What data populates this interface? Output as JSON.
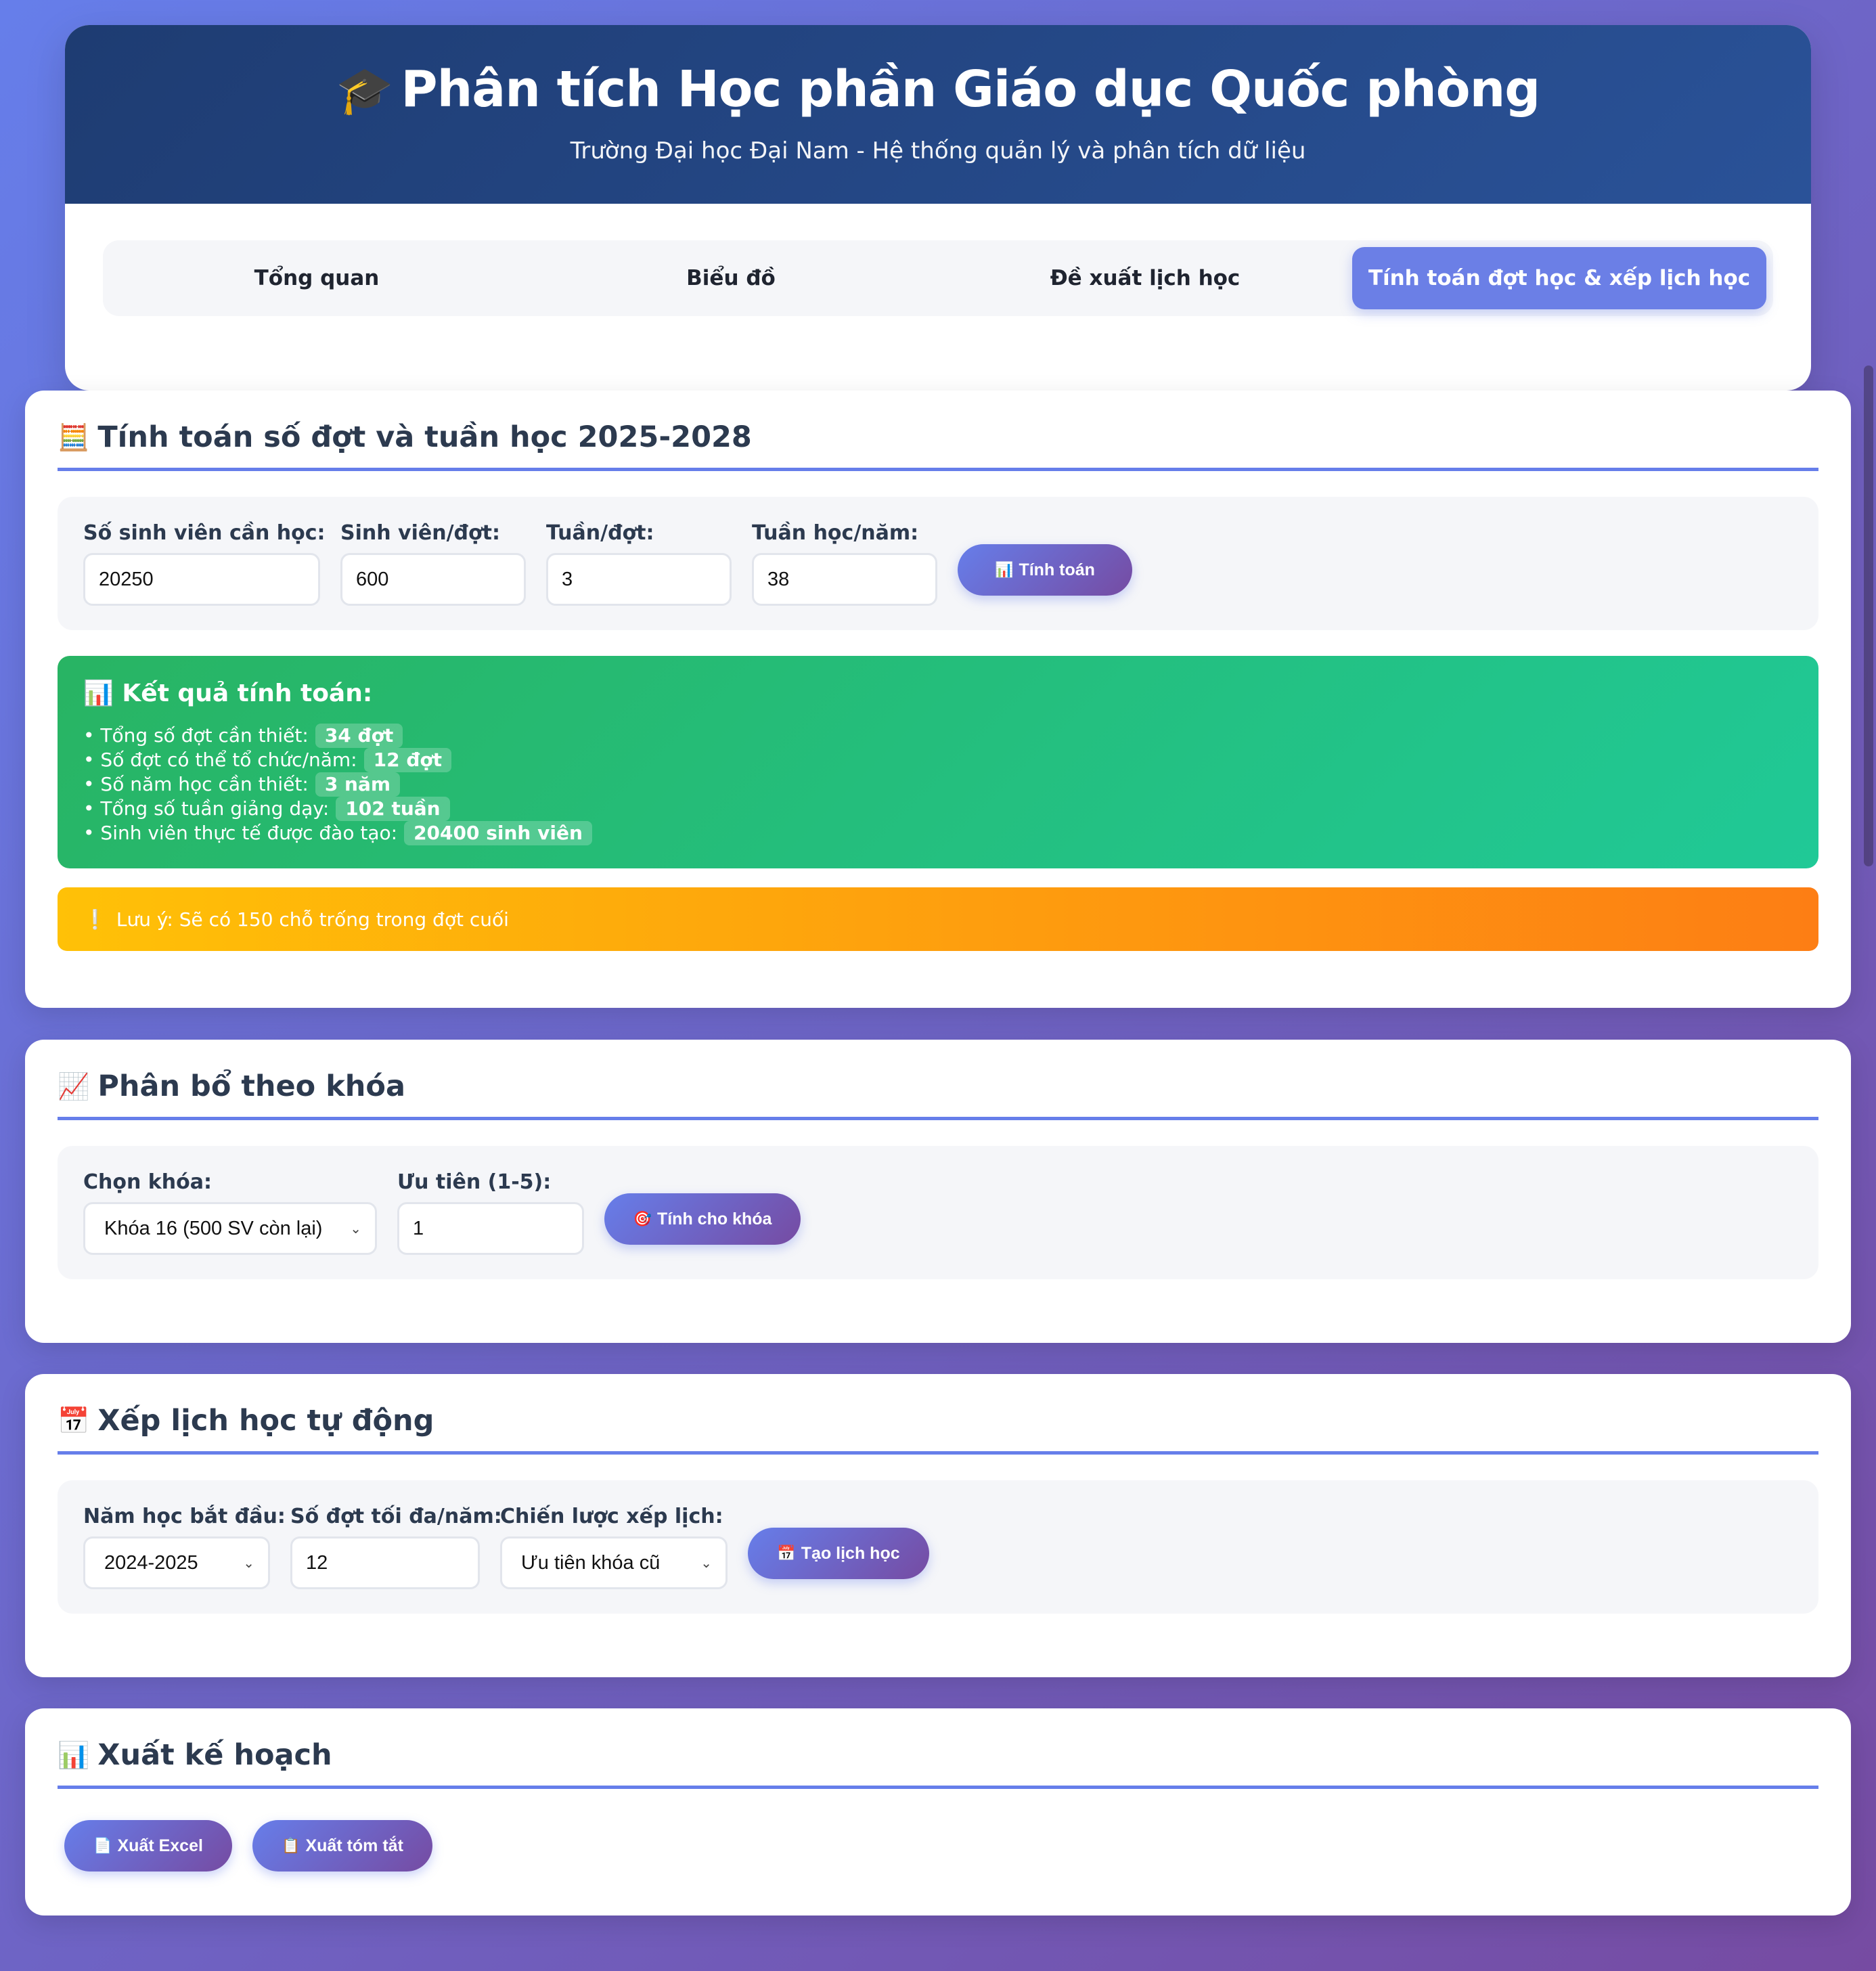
{
  "header": {
    "icon": "graduation-cap-icon",
    "emoji": "🎓",
    "title": "Phân tích Học phần Giáo dục Quốc phòng",
    "subtitle": "Trường Đại học Đại Nam - Hệ thống quản lý và phân tích dữ liệu"
  },
  "tabs": [
    {
      "label": "Tổng quan",
      "active": false
    },
    {
      "label": "Biểu đồ",
      "active": false
    },
    {
      "label": "Đề xuất lịch học",
      "active": false
    },
    {
      "label": "Tính toán đợt học & xếp lịch học",
      "active": true
    }
  ],
  "calc": {
    "emoji": "🧮",
    "title": "Tính toán số đợt và tuần học 2025-2028",
    "fields": [
      {
        "label": "Số sinh viên cần học:",
        "value": "20250"
      },
      {
        "label": "Sinh viên/đợt:",
        "value": "600"
      },
      {
        "label": "Tuần/đợt:",
        "value": "3"
      },
      {
        "label": "Tuần học/năm:",
        "value": "38"
      }
    ],
    "button": {
      "emoji": "📊",
      "label": "Tính toán"
    },
    "result": {
      "emoji": "📊",
      "title": "Kết quả tính toán:",
      "rows": [
        {
          "label": "• Tổng số đợt cần thiết:",
          "value": "34 đợt"
        },
        {
          "label": "• Số đợt có thể tổ chức/năm:",
          "value": "12 đợt"
        },
        {
          "label": "• Số năm học cần thiết:",
          "value": "3 năm"
        },
        {
          "label": "• Tổng số tuần giảng dạy:",
          "value": "102 tuần"
        },
        {
          "label": "• Sinh viên thực tế được đào tạo:",
          "value": "20400 sinh viên"
        }
      ]
    },
    "warning": {
      "emoji": "❕",
      "text": "Lưu ý: Sẽ có 150 chỗ trống trong đợt cuối"
    }
  },
  "allocation": {
    "emoji": "📈",
    "title": "Phân bổ theo khóa",
    "course_label": "Chọn khóa:",
    "course_value": "Khóa 16 (500 SV còn lại)",
    "priority_label": "Ưu tiên (1-5):",
    "priority_value": "1",
    "button": {
      "emoji": "🎯",
      "label": "Tính cho khóa"
    }
  },
  "schedule": {
    "emoji": "📅",
    "title": "Xếp lịch học tự động",
    "year_label": "Năm học bắt đầu:",
    "year_value": "2024-2025",
    "max_label": "Số đợt tối đa/năm:",
    "max_value": "12",
    "strategy_label": "Chiến lược xếp lịch:",
    "strategy_value": "Ưu tiên khóa cũ",
    "button": {
      "emoji": "📅",
      "label": "Tạo lịch học"
    }
  },
  "export": {
    "emoji": "📊",
    "title": "Xuất kế hoạch",
    "excel": {
      "emoji": "📄",
      "label": "Xuất Excel"
    },
    "summary": {
      "emoji": "📋",
      "label": "Xuất tóm tắt"
    }
  },
  "colors": {
    "bg_start": "#667eea",
    "bg_end": "#764ba2",
    "header_start": "#1e3c72",
    "header_end": "#2a5298",
    "success": "#28b463",
    "warning": "#ffc107"
  }
}
